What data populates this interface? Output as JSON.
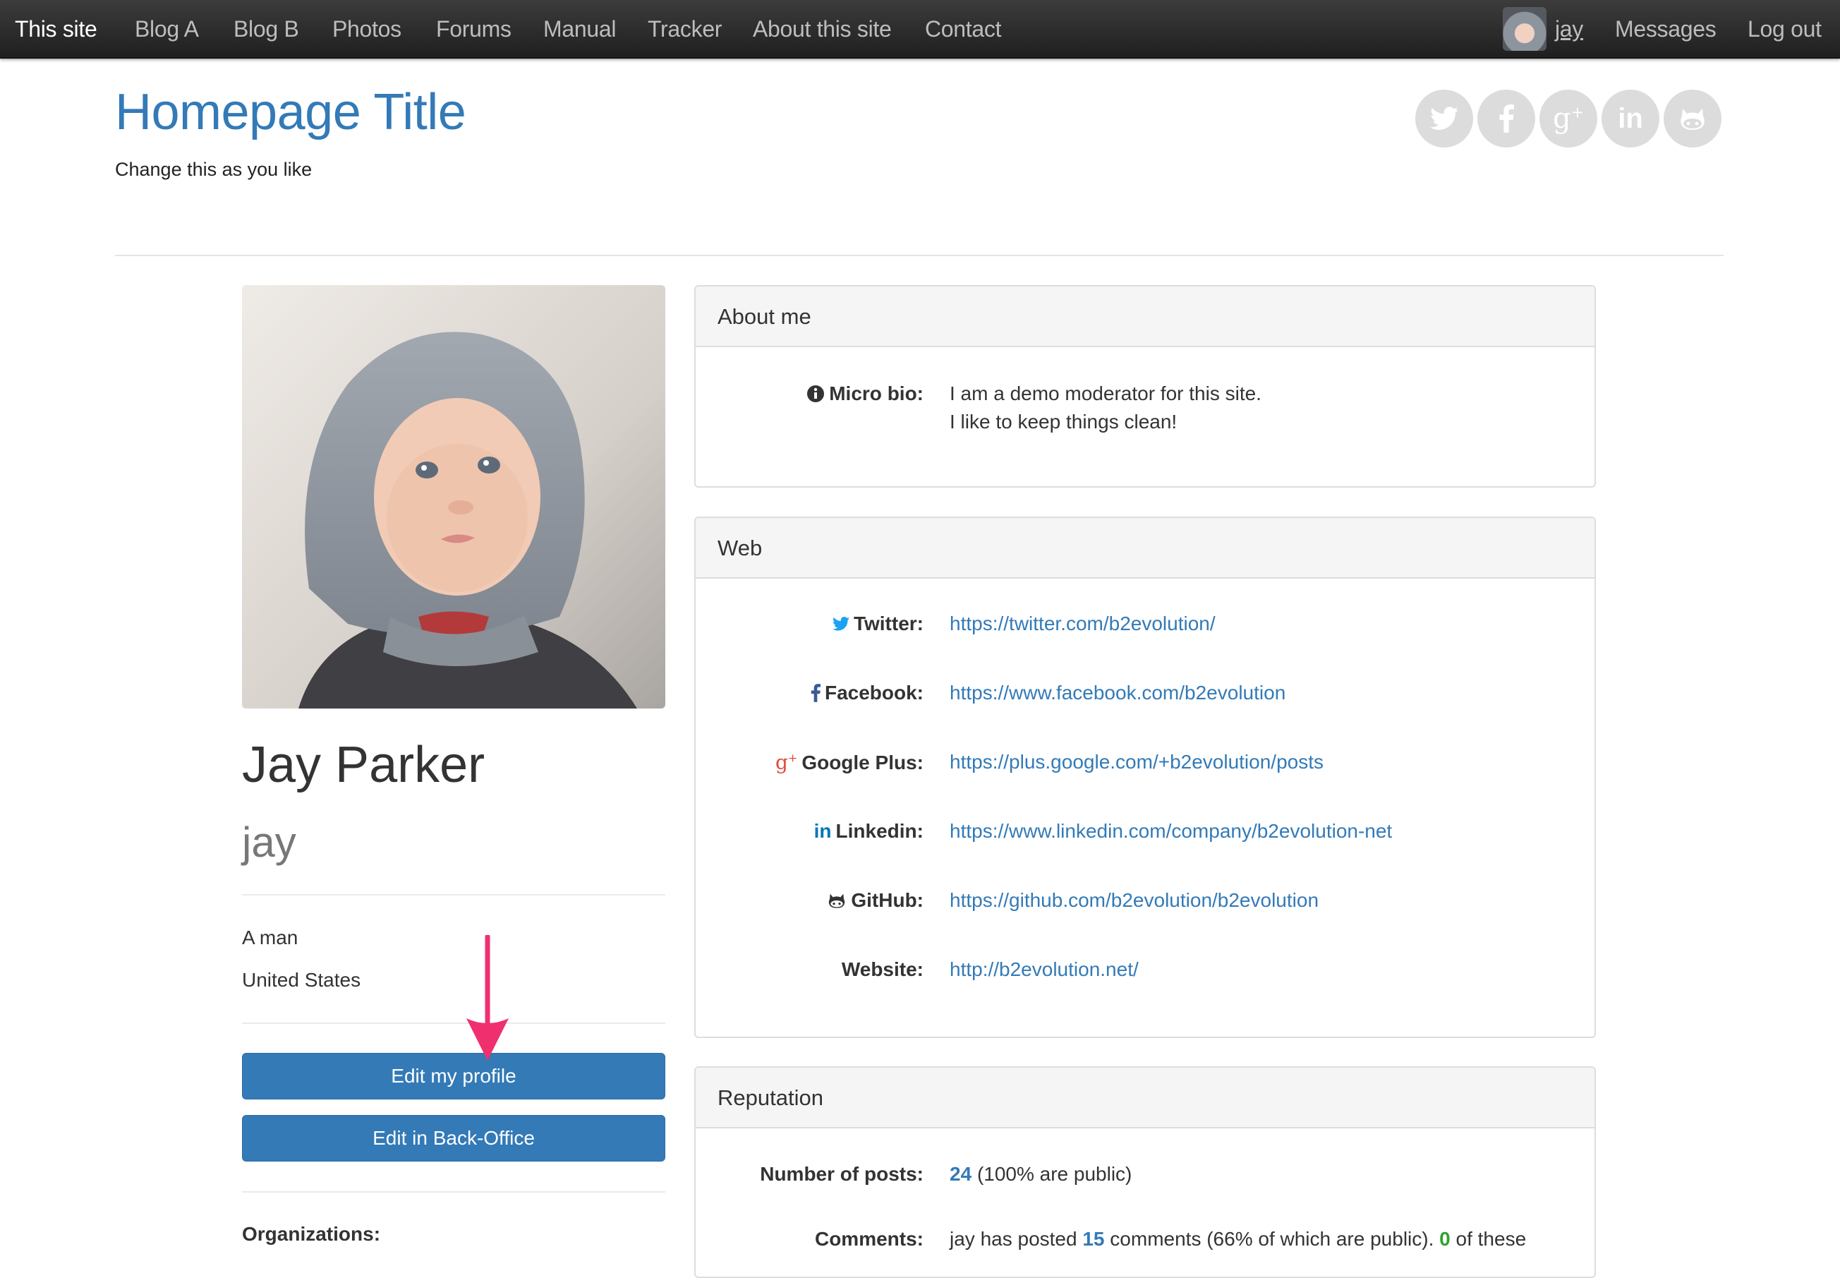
{
  "nav": {
    "items": [
      "This site",
      "Blog A",
      "Blog B",
      "Photos",
      "Forums",
      "Manual",
      "Tracker",
      "About this site",
      "Contact"
    ],
    "user": "jay",
    "messages": "Messages",
    "logout": "Log out"
  },
  "header": {
    "title": "Homepage Title",
    "tagline": "Change this as you like",
    "social_icons": [
      "twitter-icon",
      "facebook-icon",
      "google-plus-icon",
      "linkedin-icon",
      "github-icon"
    ]
  },
  "profile": {
    "full_name": "Jay Parker",
    "login": "jay",
    "gender": "A man",
    "country": "United States",
    "edit_profile_button": "Edit my profile",
    "edit_backoffice_button": "Edit in Back-Office",
    "organizations_label": "Organizations:"
  },
  "about": {
    "heading": "About me",
    "micro_bio_label": "Micro bio:",
    "micro_bio_line1": "I am a demo moderator for this site.",
    "micro_bio_line2": "I like to keep things clean!"
  },
  "web": {
    "heading": "Web",
    "links": [
      {
        "label": "Twitter:",
        "url": "https://twitter.com/b2evolution/"
      },
      {
        "label": "Facebook:",
        "url": "https://www.facebook.com/b2evolution"
      },
      {
        "label": "Google Plus:",
        "url": "https://plus.google.com/+b2evolution/posts"
      },
      {
        "label": "Linkedin:",
        "url": "https://www.linkedin.com/company/b2evolution-net"
      },
      {
        "label": "GitHub:",
        "url": "https://github.com/b2evolution/b2evolution"
      },
      {
        "label": "Website:",
        "url": "http://b2evolution.net/"
      }
    ]
  },
  "reputation": {
    "heading": "Reputation",
    "posts_label": "Number of posts:",
    "posts_count": "24",
    "posts_note": "(100% are public)",
    "comments_label": "Comments:",
    "comments_prefix": "jay has posted",
    "comments_count": "15",
    "comments_middle": "comments (66% of which are public).",
    "comments_green": "0",
    "comments_suffix": "of these"
  },
  "colors": {
    "accent": "#337ab7",
    "navbar": "#2b2b2b",
    "twitter": "#1da1f2",
    "google_plus": "#dd4b39",
    "linkedin": "#0077b5",
    "arrow": "#f0306e"
  }
}
